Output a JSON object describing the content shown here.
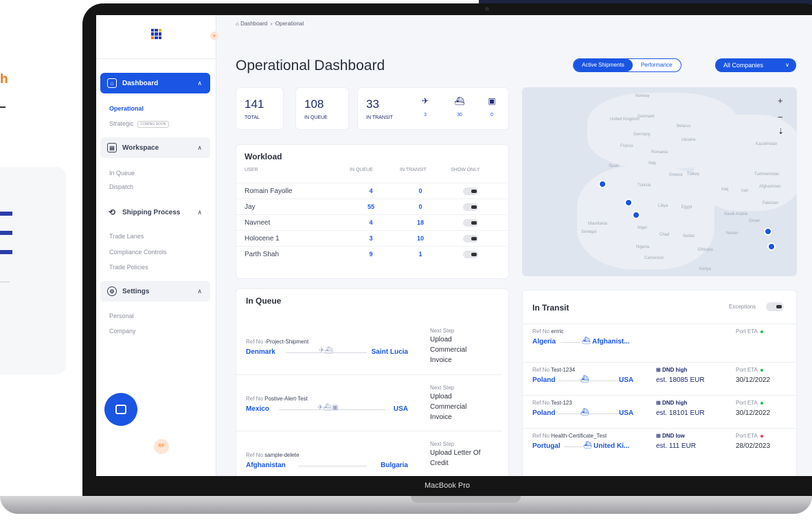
{
  "breadcrumb": {
    "home": "Dashboard",
    "current": "Operational"
  },
  "page_title": "Operational Dashboard",
  "view_toggle": {
    "active": "Active Shipments",
    "other": "Performance"
  },
  "company_select": {
    "label": "All Companies"
  },
  "sidebar": {
    "sections": [
      {
        "label": "Dashboard",
        "icon": "home-icon",
        "items": [
          {
            "label": "Operational"
          },
          {
            "label": "Strategic",
            "badge": "COMING SOON"
          }
        ]
      },
      {
        "label": "Workspace",
        "icon": "workspace-icon",
        "items": [
          {
            "label": "In Queue"
          },
          {
            "label": "Dispatch"
          }
        ]
      },
      {
        "label": "Shipping Process",
        "icon": "route-icon",
        "items": [
          {
            "label": "Trade Lanes"
          },
          {
            "label": "Compliance Controls"
          },
          {
            "label": "Trade Policies"
          }
        ]
      },
      {
        "label": "Settings",
        "icon": "gear-icon",
        "items": [
          {
            "label": "Personal"
          },
          {
            "label": "Company"
          }
        ]
      }
    ],
    "avatar_initials": "RF"
  },
  "stats": {
    "total": {
      "value": "141",
      "label": "TOTAL"
    },
    "queue": {
      "value": "108",
      "label": "IN QUEUE"
    },
    "transit": {
      "value": "33",
      "label": "IN TRANSIT"
    },
    "air": "3",
    "ship": "30",
    "rail": "0"
  },
  "workload": {
    "title": "Workload",
    "headers": {
      "user": "USER",
      "queue": "IN QUEUE",
      "transit": "IN TRANSIT",
      "show": "SHOW ONLY"
    },
    "rows": [
      {
        "user": "Romain Fayolle",
        "queue": "4",
        "transit": "0"
      },
      {
        "user": "Jay",
        "queue": "55",
        "transit": "0"
      },
      {
        "user": "Navneet",
        "queue": "4",
        "transit": "18"
      },
      {
        "user": "Holocene 1",
        "queue": "3",
        "transit": "10"
      },
      {
        "user": "Parth Shah",
        "queue": "9",
        "transit": "1"
      }
    ]
  },
  "map": {
    "labels": [
      "Norway",
      "United Kingdom",
      "Denmark",
      "Belarus",
      "Germany",
      "Ukraine",
      "France",
      "Romania",
      "Kazakhstan",
      "Spain",
      "Italy",
      "Greece",
      "Turkey",
      "Turkmenistan",
      "Tunisia",
      "Iraq",
      "Iran",
      "Afghanistan",
      "Pakistan",
      "Libya",
      "Egypt",
      "Saudi Arabia",
      "Oman",
      "Mauritania",
      "Senegal",
      "Niger",
      "Chad",
      "Sudan",
      "Yemen",
      "Nigeria",
      "Ethiopia",
      "Cameroon",
      "Kenya"
    ]
  },
  "in_queue": {
    "title": "In Queue",
    "ref_prefix": "Ref No",
    "next_step_label": "Next Step",
    "rows": [
      {
        "ref": "-Project-Shipment",
        "from": "Denmark",
        "to": "Saint Lucia",
        "next": "Upload Commercial Invoice"
      },
      {
        "ref": "Postive-Alert-Test",
        "from": "Mexico",
        "to": "USA",
        "next": "Upload Commercial Invoice"
      },
      {
        "ref": "sample-delete",
        "from": "Afghanistan",
        "to": "Bulgaria",
        "next": "Upload Letter Of Credit"
      }
    ]
  },
  "in_transit": {
    "title": "In Transit",
    "exceptions_label": "Exceptions",
    "ref_prefix": "Ref No",
    "eta_label": "Port ETA",
    "rows": [
      {
        "ref": "errric",
        "from": "Algeria",
        "to": "Afghanist...",
        "dnd": "",
        "est": "",
        "eta": "",
        "status_color": "#1fbf5c"
      },
      {
        "ref": "Test-1234",
        "from": "Poland",
        "to": "USA",
        "dnd": "DND high",
        "est": "est. 18085 EUR",
        "eta": "30/12/2022",
        "status_color": "#1fbf5c"
      },
      {
        "ref": "Test-123",
        "from": "Poland",
        "to": "USA",
        "dnd": "DND high",
        "est": "est. 18101 EUR",
        "eta": "30/12/2022",
        "status_color": "#1fbf5c"
      },
      {
        "ref": "Health-Certificate_Test",
        "from": "Portugal",
        "to": "United Ki...",
        "dnd": "DND low",
        "est": "est. 111 EUR",
        "eta": "28/02/2023",
        "status_color": "#e8384f"
      }
    ]
  },
  "device_label": "MacBook Pro",
  "colors": {
    "primary": "#1a55e3",
    "accent": "#f47a20",
    "navy": "#1e2a6e"
  }
}
